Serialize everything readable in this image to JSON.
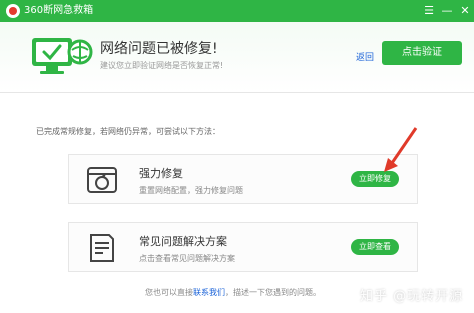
{
  "window": {
    "title": "360断网急救箱",
    "menu_glyph": "☰",
    "minimize_glyph": "—",
    "close_glyph": "✕"
  },
  "banner": {
    "title": "网络问题已被修复!",
    "subtitle": "建议您立即验证网络是否恢复正常!",
    "back_label": "返回",
    "verify_label": "点击验证"
  },
  "intro": "已完成常规修复，若网络仍异常，可尝试以下方法：",
  "cards": [
    {
      "title": "强力修复",
      "desc": "重置网络配置，强力修复问题",
      "button": "立即修复",
      "icon": "repair-icon"
    },
    {
      "title": "常见问题解决方案",
      "desc": "点击查看常见问题解决方案",
      "button": "立即查看",
      "icon": "document-icon"
    }
  ],
  "footer": {
    "prefix": "您也可以直接",
    "link": "联系我们",
    "suffix": "，描述一下您遇到的问题。"
  },
  "watermark": "知乎 @玩转开源",
  "colors": {
    "accent": "#2fb545",
    "link": "#1b63d8",
    "arrow": "#e03a2a"
  }
}
